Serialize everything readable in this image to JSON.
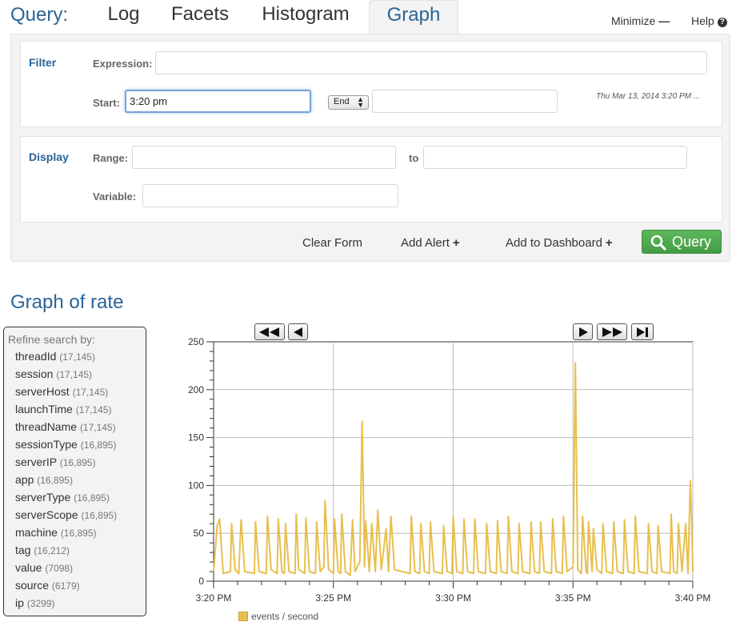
{
  "app": {
    "brand": "Query:"
  },
  "tabs": [
    {
      "label": "Log"
    },
    {
      "label": "Facets"
    },
    {
      "label": "Histogram"
    },
    {
      "label": "Graph"
    }
  ],
  "header": {
    "minimize_label": "Minimize",
    "help_label": "Help"
  },
  "filter": {
    "section_label": "Filter",
    "expression_label": "Expression:",
    "expression_value": "",
    "start_label": "Start:",
    "start_value": "3:20 pm",
    "end_select": "End",
    "end_value": "",
    "timestamp": "Thu Mar 13, 2014 3:20 PM ..."
  },
  "display": {
    "section_label": "Display",
    "range_label": "Range:",
    "range_from": "",
    "range_to_label": "to",
    "range_to": "",
    "variable_label": "Variable:",
    "variable_value": ""
  },
  "actions": {
    "clear_form": "Clear Form",
    "add_alert": "Add Alert",
    "add_dashboard": "Add to Dashboard",
    "query": "Query"
  },
  "graph_title": "Graph of rate",
  "refine": {
    "title": "Refine search by:",
    "items": [
      {
        "name": "threadId",
        "count": "(17,145)"
      },
      {
        "name": "session",
        "count": "(17,145)"
      },
      {
        "name": "serverHost",
        "count": "(17,145)"
      },
      {
        "name": "launchTime",
        "count": "(17,145)"
      },
      {
        "name": "threadName",
        "count": "(17,145)"
      },
      {
        "name": "sessionType",
        "count": "(16,895)"
      },
      {
        "name": "serverIP",
        "count": "(16,895)"
      },
      {
        "name": "app",
        "count": "(16,895)"
      },
      {
        "name": "serverType",
        "count": "(16,895)"
      },
      {
        "name": "serverScope",
        "count": "(16,895)"
      },
      {
        "name": "machine",
        "count": "(16,895)"
      },
      {
        "name": "tag",
        "count": "(16,212)"
      },
      {
        "name": "value",
        "count": "(7098)"
      },
      {
        "name": "source",
        "count": "(6179)"
      },
      {
        "name": "ip",
        "count": "(3299)"
      }
    ]
  },
  "colors": {
    "accent": "#2a6496",
    "query_button": "#5cb85c",
    "series": "#e8bf4e"
  },
  "chart_data": {
    "type": "line",
    "x_ticks": [
      "3:20 PM",
      "3:25 PM",
      "3:30 PM",
      "3:35 PM",
      "3:40 PM"
    ],
    "y_ticks": [
      0,
      50,
      100,
      150,
      200,
      250
    ],
    "ylim": [
      0,
      250
    ],
    "xlim_minutes_after_320pm": [
      0,
      20
    ],
    "grid": true,
    "legend_position": "bottom",
    "series": [
      {
        "name": "events / second",
        "points": [
          [
            0.0,
            10
          ],
          [
            0.15,
            58
          ],
          [
            0.25,
            65
          ],
          [
            0.4,
            8
          ],
          [
            0.7,
            10
          ],
          [
            0.75,
            60
          ],
          [
            0.9,
            12
          ],
          [
            1.05,
            8
          ],
          [
            1.15,
            64
          ],
          [
            1.3,
            10
          ],
          [
            1.7,
            8
          ],
          [
            1.75,
            62
          ],
          [
            1.9,
            10
          ],
          [
            2.2,
            8
          ],
          [
            2.25,
            68
          ],
          [
            2.4,
            12
          ],
          [
            2.65,
            8
          ],
          [
            2.7,
            65
          ],
          [
            2.85,
            10
          ],
          [
            2.95,
            8
          ],
          [
            3.0,
            60
          ],
          [
            3.15,
            10
          ],
          [
            3.4,
            8
          ],
          [
            3.45,
            70
          ],
          [
            3.55,
            12
          ],
          [
            3.8,
            8
          ],
          [
            3.85,
            66
          ],
          [
            4.0,
            10
          ],
          [
            4.25,
            8
          ],
          [
            4.3,
            62
          ],
          [
            4.45,
            10
          ],
          [
            4.6,
            15
          ],
          [
            4.65,
            84
          ],
          [
            4.8,
            12
          ],
          [
            5.0,
            8
          ],
          [
            5.05,
            65
          ],
          [
            5.2,
            10
          ],
          [
            5.3,
            8
          ],
          [
            5.35,
            70
          ],
          [
            5.5,
            10
          ],
          [
            5.7,
            6
          ],
          [
            5.8,
            64
          ],
          [
            5.9,
            10
          ],
          [
            6.1,
            20
          ],
          [
            6.2,
            167
          ],
          [
            6.3,
            15
          ],
          [
            6.35,
            63
          ],
          [
            6.5,
            10
          ],
          [
            6.6,
            60
          ],
          [
            6.75,
            10
          ],
          [
            6.85,
            74
          ],
          [
            7.0,
            12
          ],
          [
            7.2,
            55
          ],
          [
            7.3,
            10
          ],
          [
            7.4,
            68
          ],
          [
            7.55,
            12
          ],
          [
            8.2,
            8
          ],
          [
            8.25,
            68
          ],
          [
            8.4,
            10
          ],
          [
            8.6,
            8
          ],
          [
            8.65,
            60
          ],
          [
            8.8,
            10
          ],
          [
            9.0,
            8
          ],
          [
            9.05,
            62
          ],
          [
            9.2,
            10
          ],
          [
            9.55,
            8
          ],
          [
            9.6,
            58
          ],
          [
            9.75,
            10
          ],
          [
            9.95,
            8
          ],
          [
            10.0,
            67
          ],
          [
            10.15,
            10
          ],
          [
            10.4,
            8
          ],
          [
            10.45,
            65
          ],
          [
            10.6,
            10
          ],
          [
            10.85,
            8
          ],
          [
            10.9,
            65
          ],
          [
            11.05,
            10
          ],
          [
            11.35,
            8
          ],
          [
            11.4,
            60
          ],
          [
            11.55,
            10
          ],
          [
            11.8,
            8
          ],
          [
            11.85,
            63
          ],
          [
            12.0,
            10
          ],
          [
            12.25,
            8
          ],
          [
            12.3,
            68
          ],
          [
            12.45,
            10
          ],
          [
            12.7,
            8
          ],
          [
            12.75,
            60
          ],
          [
            12.9,
            10
          ],
          [
            13.2,
            8
          ],
          [
            13.25,
            62
          ],
          [
            13.4,
            10
          ],
          [
            13.6,
            8
          ],
          [
            13.65,
            62
          ],
          [
            13.8,
            10
          ],
          [
            14.1,
            8
          ],
          [
            14.15,
            65
          ],
          [
            14.3,
            10
          ],
          [
            14.55,
            8
          ],
          [
            14.6,
            68
          ],
          [
            14.75,
            10
          ],
          [
            15.0,
            15
          ],
          [
            15.1,
            228
          ],
          [
            15.2,
            12
          ],
          [
            15.35,
            8
          ],
          [
            15.4,
            68
          ],
          [
            15.55,
            10
          ],
          [
            15.6,
            8
          ],
          [
            15.65,
            62
          ],
          [
            15.8,
            10
          ],
          [
            15.85,
            55
          ],
          [
            16.0,
            12
          ],
          [
            16.2,
            8
          ],
          [
            16.25,
            60
          ],
          [
            16.4,
            10
          ],
          [
            16.65,
            8
          ],
          [
            16.7,
            62
          ],
          [
            16.85,
            10
          ],
          [
            17.1,
            8
          ],
          [
            17.15,
            64
          ],
          [
            17.3,
            10
          ],
          [
            17.55,
            8
          ],
          [
            17.6,
            68
          ],
          [
            17.75,
            10
          ],
          [
            18.1,
            8
          ],
          [
            18.15,
            60
          ],
          [
            18.3,
            10
          ],
          [
            18.5,
            8
          ],
          [
            18.55,
            58
          ],
          [
            18.7,
            10
          ],
          [
            19.05,
            8
          ],
          [
            19.1,
            70
          ],
          [
            19.2,
            10
          ],
          [
            19.35,
            8
          ],
          [
            19.4,
            60
          ],
          [
            19.55,
            10
          ],
          [
            19.7,
            60
          ],
          [
            19.8,
            8
          ],
          [
            19.85,
            60
          ],
          [
            19.9,
            105
          ],
          [
            19.95,
            65
          ],
          [
            20.0,
            10
          ]
        ]
      }
    ]
  }
}
